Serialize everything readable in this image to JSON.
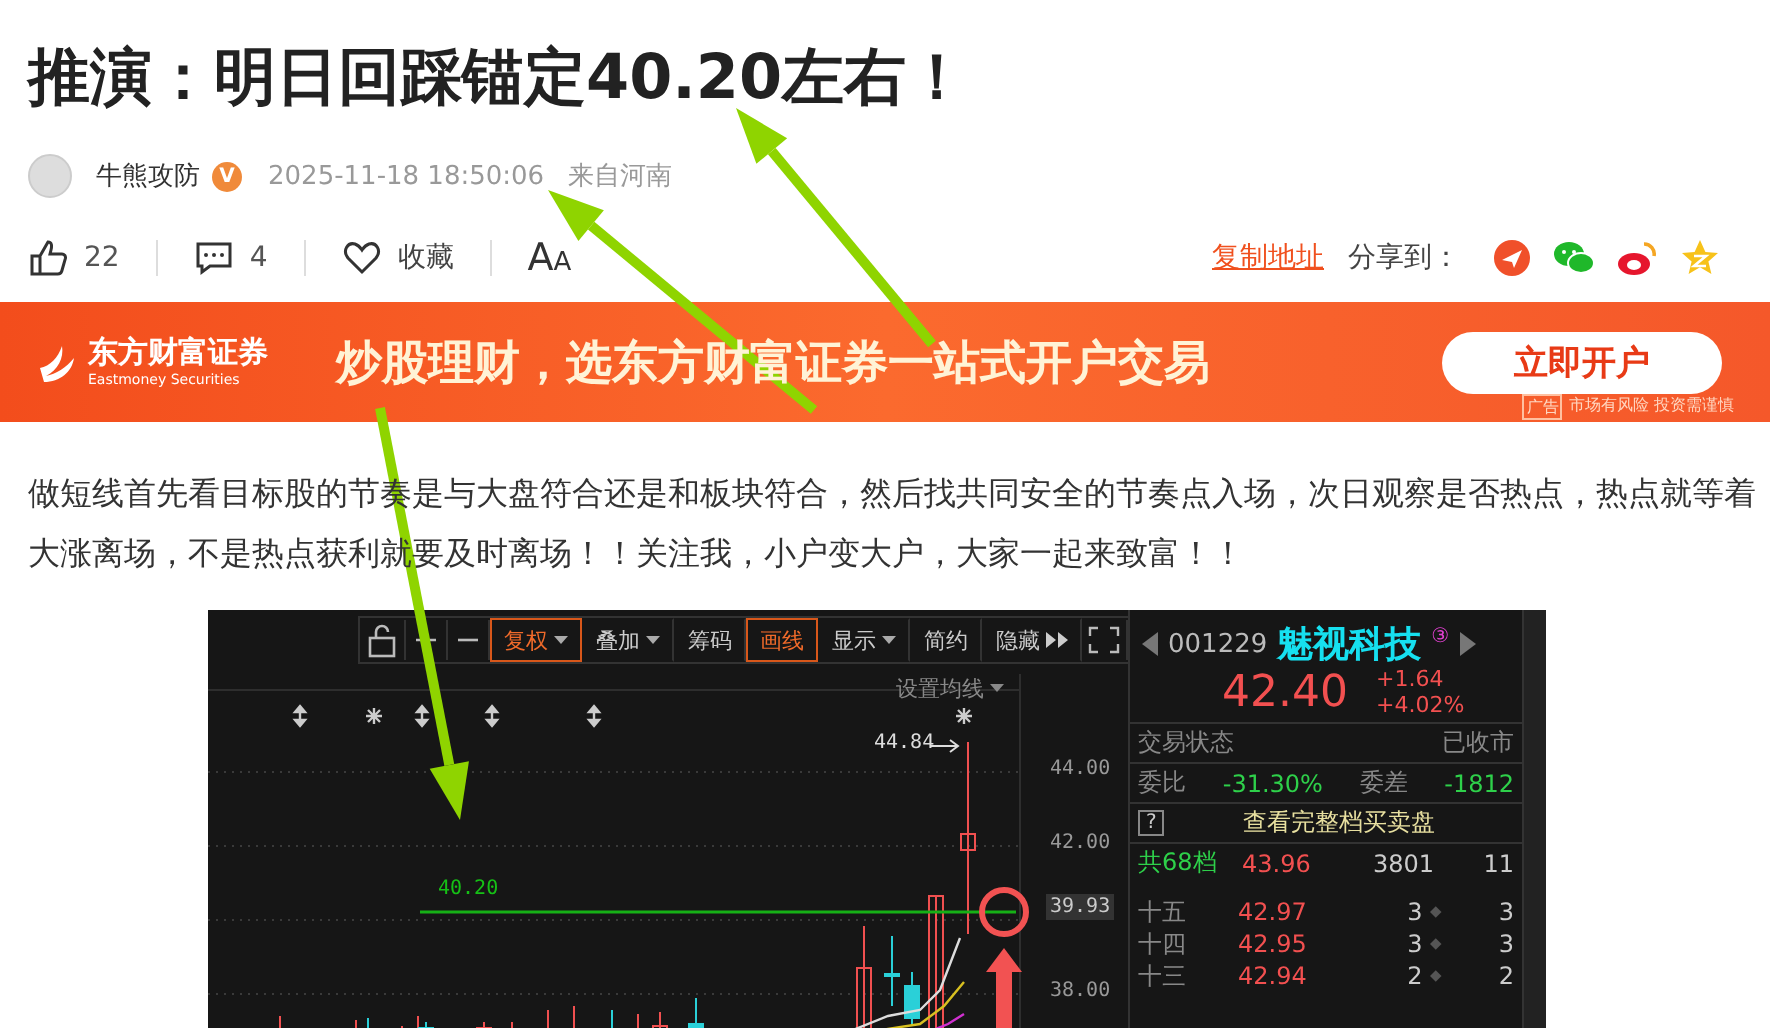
{
  "article": {
    "title": "推演：明日回踩锚定40.20左右！",
    "author": "牛熊攻防",
    "verified_badge": "V",
    "time": "2025-11-18 18:50:06",
    "location": "来自河南"
  },
  "actions": {
    "likes": "22",
    "comments": "4",
    "favorite": "收藏",
    "font_big": "A",
    "font_small": "A",
    "copy_link": "复制地址",
    "share_label": "分享到："
  },
  "banner": {
    "brand": "东方财富证券",
    "brand_en": "Eastmoney Securities",
    "slogan": "炒股理财，选东方财富证券一站式开户交易",
    "button": "立即开户",
    "ad_tag": "广告",
    "disclaimer": "市场有风险 投资需谨慎"
  },
  "body": "做短线首先看目标股的节奏是与大盘符合还是和板块符合，然后找共同安全的节奏点入场，次日观察是否热点，热点就等着大涨离场，不是热点获利就要及时离场！！关注我，小户变大户，大家一起来致富！！",
  "stock_app": {
    "toolbar": [
      {
        "label": "复权",
        "kind": "dropdown",
        "selected": true
      },
      {
        "label": "叠加",
        "kind": "dropdown",
        "selected": false
      },
      {
        "label": "筹码",
        "kind": "plain",
        "selected": false
      },
      {
        "label": "画线",
        "kind": "plain",
        "selected": true
      },
      {
        "label": "显示",
        "kind": "dropdown",
        "selected": false
      },
      {
        "label": "简约",
        "kind": "plain",
        "selected": false
      },
      {
        "label": "隐藏",
        "kind": "more",
        "selected": false
      }
    ],
    "ma_setting": "设置均线",
    "high_label": "44.84",
    "line_label": "40.20",
    "y_ticks": [
      {
        "label": "44.00",
        "kind": "tick"
      },
      {
        "label": "42.00",
        "kind": "tick"
      },
      {
        "label": "39.93",
        "kind": "current"
      },
      {
        "label": "38.00",
        "kind": "tick"
      }
    ],
    "quote": {
      "code": "001229",
      "name": "魅视科技",
      "badge": "③",
      "price": "42.40",
      "change": "+1.64",
      "change_pct": "+4.02%"
    },
    "status_label": "交易状态",
    "status": "已收市",
    "ratio_label": "委比",
    "ratio": "-31.30%",
    "diff_label": "委差",
    "diff": "-1812",
    "help": "?",
    "full_book": "查看完整档买卖盘",
    "total": {
      "label": "共68档",
      "price": "43.96",
      "volume": "3801",
      "count": "11"
    },
    "levels": [
      {
        "label": "十五",
        "price": "42.97",
        "volume": "3",
        "count": "3"
      },
      {
        "label": "十四",
        "price": "42.95",
        "volume": "3",
        "count": "3"
      },
      {
        "label": "十三",
        "price": "42.94",
        "volume": "2",
        "count": "2"
      }
    ]
  }
}
